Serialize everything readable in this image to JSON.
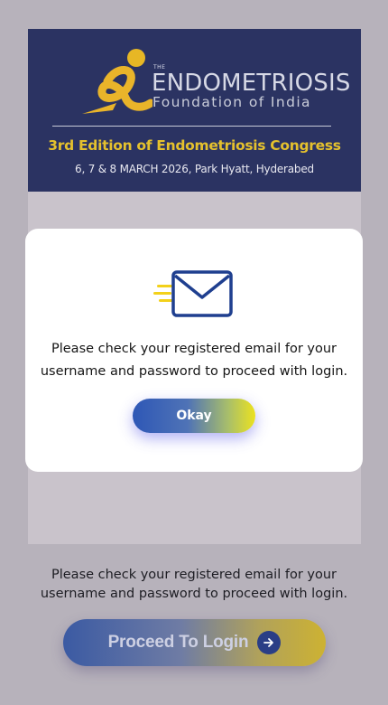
{
  "banner": {
    "logo_small": "THE",
    "logo_line1": "ENDOMETRIOSIS",
    "logo_line2": "Foundation of India",
    "title": "3rd Edition of Endometriosis Congress",
    "subtitle": "6, 7 & 8 MARCH 2026, Park Hyatt, Hyderabed"
  },
  "page": {
    "message_line1": "Please check your registered email for your",
    "message_line2": "username and password to proceed with login.",
    "proceed_label": "Proceed To Login",
    "proceed_icon": "arrow-right-icon"
  },
  "modal": {
    "icon": "mail-icon",
    "message_line1": "Please check your registered email for your",
    "message_line2": "username and password to proceed with login.",
    "okay_label": "Okay"
  },
  "colors": {
    "banner_bg": "#2b3362",
    "title_gold": "#e5c12d",
    "icon_blue": "#1f3f8f",
    "icon_yellow": "#f3d11a"
  }
}
